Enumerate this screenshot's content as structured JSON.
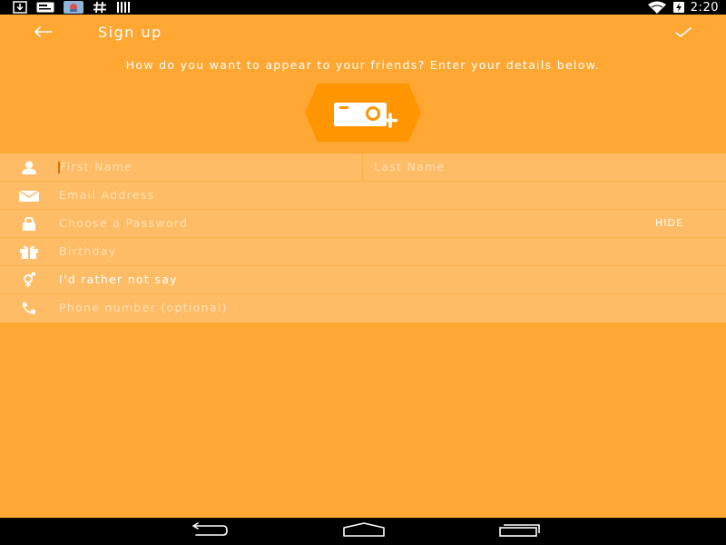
{
  "status_bar": {
    "time": "2:20",
    "left_icons": [
      "download-icon",
      "message-icon",
      "app-thumbnail-icon",
      "hashtag-icon",
      "barcode-icon"
    ],
    "right_icons": [
      "wifi-icon",
      "battery-charging-icon"
    ]
  },
  "header": {
    "title": "Sign up",
    "back_icon": "arrow-left-icon",
    "confirm_icon": "checkmark-icon"
  },
  "subtitle": "How do you want to appear to your friends? Enter your details below.",
  "avatar": {
    "icon": "camera-add-icon"
  },
  "form": {
    "first_name": {
      "placeholder": "First Name",
      "icon": "person-icon"
    },
    "last_name": {
      "placeholder": "Last Name"
    },
    "email": {
      "placeholder": "Email Address",
      "icon": "envelope-icon"
    },
    "password": {
      "placeholder": "Choose a Password",
      "icon": "lock-icon",
      "toggle_label": "HIDE"
    },
    "birthday": {
      "placeholder": "Birthday",
      "icon": "gift-icon"
    },
    "gender": {
      "value": "I'd rather not say",
      "icon": "gender-icon"
    },
    "phone": {
      "placeholder": "Phone number (optional)",
      "icon": "phone-icon"
    }
  },
  "nav_bar": {
    "icons": [
      "back-nav-icon",
      "home-nav-icon",
      "recents-nav-icon"
    ]
  },
  "colors": {
    "background": "#FFA733",
    "form_background": "#FFBC66",
    "avatar_hex": "#FF9500",
    "caret": "#E86A00",
    "bars": "#000000"
  }
}
